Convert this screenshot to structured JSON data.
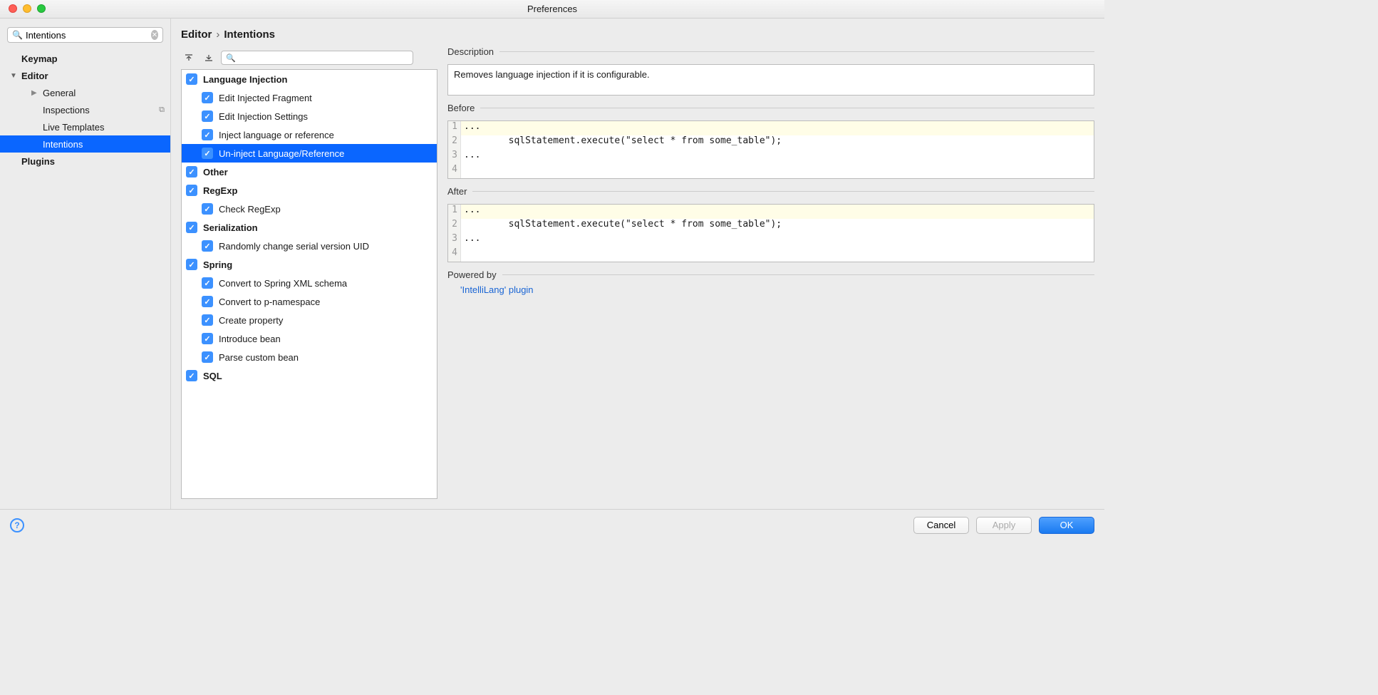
{
  "window": {
    "title": "Preferences"
  },
  "sidebar": {
    "search_value": "Intentions",
    "items": {
      "keymap": "Keymap",
      "editor": "Editor",
      "general": "General",
      "inspections": "Inspections",
      "live_templates": "Live Templates",
      "intentions": "Intentions",
      "plugins": "Plugins"
    }
  },
  "breadcrumb": {
    "a": "Editor",
    "b": "Intentions"
  },
  "tree_search": "",
  "tree": {
    "lang_injection": "Language Injection",
    "edit_injected_fragment": "Edit Injected Fragment",
    "edit_injection_settings": "Edit Injection Settings",
    "inject_lang": "Inject language or reference",
    "uninject": "Un-inject Language/Reference",
    "other": "Other",
    "regexp": "RegExp",
    "check_regexp": "Check RegExp",
    "serialization": "Serialization",
    "random_serial": "Randomly change serial version UID",
    "spring": "Spring",
    "convert_xml": "Convert to Spring XML schema",
    "convert_pns": "Convert to p-namespace",
    "create_property": "Create property",
    "introduce_bean": "Introduce bean",
    "parse_custom_bean": "Parse custom bean",
    "sql": "SQL"
  },
  "details": {
    "desc_label": "Description",
    "desc_text": "Removes language injection if it is configurable.",
    "before_label": "Before",
    "after_label": "After",
    "code_before": {
      "l1": "...",
      "l2": "        sqlStatement.execute(\"select * from some_table\");",
      "l3": "..."
    },
    "code_after": {
      "l1": "...",
      "l2": "        sqlStatement.execute(\"select * from some_table\");",
      "l3": "..."
    },
    "powered_label": "Powered by",
    "powered_link": "'IntelliLang' plugin"
  },
  "buttons": {
    "cancel": "Cancel",
    "apply": "Apply",
    "ok": "OK"
  }
}
